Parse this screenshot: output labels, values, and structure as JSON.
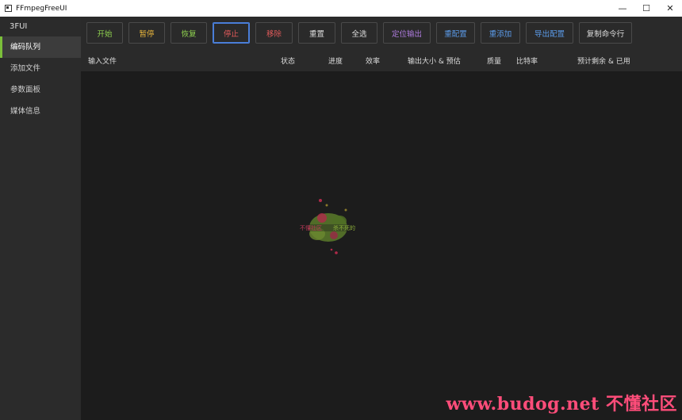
{
  "window": {
    "title": "FFmpegFreeUI",
    "minimize": "—",
    "maximize": "☐",
    "close": "✕"
  },
  "sidebar": {
    "brand": "3FUI",
    "items": [
      {
        "label": "编码队列",
        "active": true
      },
      {
        "label": "添加文件",
        "active": false
      },
      {
        "label": "参数面板",
        "active": false
      },
      {
        "label": "媒体信息",
        "active": false
      }
    ]
  },
  "toolbar": {
    "buttons": [
      {
        "label": "开始",
        "color": "#8fd14f"
      },
      {
        "label": "暂停",
        "color": "#e6b43c"
      },
      {
        "label": "恢复",
        "color": "#8fd14f"
      },
      {
        "label": "停止",
        "color": "#e05a5a"
      },
      {
        "label": "移除",
        "color": "#e05a5a"
      },
      {
        "label": "重置",
        "color": "#dddddd"
      },
      {
        "label": "全选",
        "color": "#dddddd"
      },
      {
        "label": "定位输出",
        "color": "#b07ce0"
      },
      {
        "label": "重配置",
        "color": "#5b9ae8"
      },
      {
        "label": "重添加",
        "color": "#5b9ae8"
      },
      {
        "label": "导出配置",
        "color": "#5b9ae8"
      },
      {
        "label": "复制命令行",
        "color": "#dddddd"
      }
    ]
  },
  "table": {
    "columns": [
      "输入文件",
      "状态",
      "进度",
      "效率",
      "输出大小 & 预估",
      "质量",
      "比特率",
      "预计剩余 & 已用"
    ],
    "rows": []
  },
  "watermark": {
    "logo_text_left": "不懂社区",
    "logo_text_right": "杀不死的",
    "footer": "www.budog.net 不懂社区"
  }
}
